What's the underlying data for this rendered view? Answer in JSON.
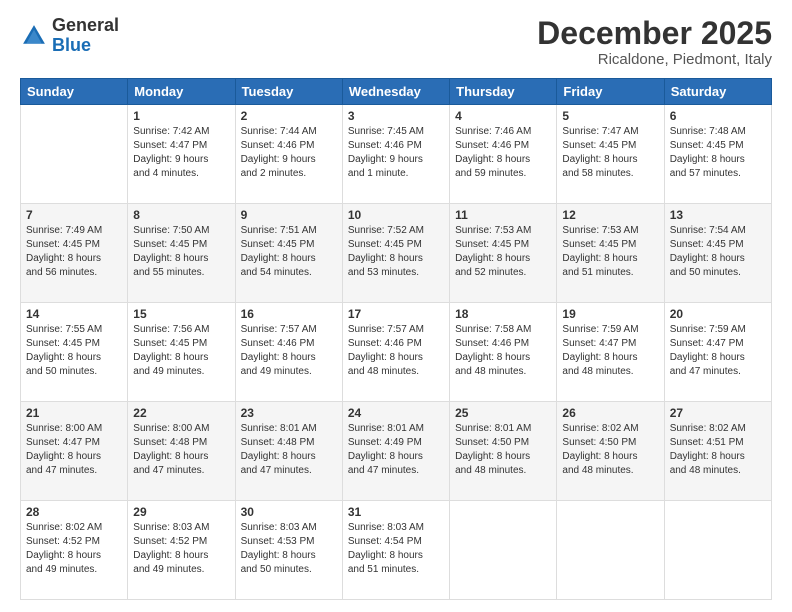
{
  "header": {
    "logo_general": "General",
    "logo_blue": "Blue",
    "month": "December 2025",
    "location": "Ricaldone, Piedmont, Italy"
  },
  "days_of_week": [
    "Sunday",
    "Monday",
    "Tuesday",
    "Wednesday",
    "Thursday",
    "Friday",
    "Saturday"
  ],
  "weeks": [
    [
      {
        "day": "",
        "info": ""
      },
      {
        "day": "1",
        "info": "Sunrise: 7:42 AM\nSunset: 4:47 PM\nDaylight: 9 hours\nand 4 minutes."
      },
      {
        "day": "2",
        "info": "Sunrise: 7:44 AM\nSunset: 4:46 PM\nDaylight: 9 hours\nand 2 minutes."
      },
      {
        "day": "3",
        "info": "Sunrise: 7:45 AM\nSunset: 4:46 PM\nDaylight: 9 hours\nand 1 minute."
      },
      {
        "day": "4",
        "info": "Sunrise: 7:46 AM\nSunset: 4:46 PM\nDaylight: 8 hours\nand 59 minutes."
      },
      {
        "day": "5",
        "info": "Sunrise: 7:47 AM\nSunset: 4:45 PM\nDaylight: 8 hours\nand 58 minutes."
      },
      {
        "day": "6",
        "info": "Sunrise: 7:48 AM\nSunset: 4:45 PM\nDaylight: 8 hours\nand 57 minutes."
      }
    ],
    [
      {
        "day": "7",
        "info": "Sunrise: 7:49 AM\nSunset: 4:45 PM\nDaylight: 8 hours\nand 56 minutes."
      },
      {
        "day": "8",
        "info": "Sunrise: 7:50 AM\nSunset: 4:45 PM\nDaylight: 8 hours\nand 55 minutes."
      },
      {
        "day": "9",
        "info": "Sunrise: 7:51 AM\nSunset: 4:45 PM\nDaylight: 8 hours\nand 54 minutes."
      },
      {
        "day": "10",
        "info": "Sunrise: 7:52 AM\nSunset: 4:45 PM\nDaylight: 8 hours\nand 53 minutes."
      },
      {
        "day": "11",
        "info": "Sunrise: 7:53 AM\nSunset: 4:45 PM\nDaylight: 8 hours\nand 52 minutes."
      },
      {
        "day": "12",
        "info": "Sunrise: 7:53 AM\nSunset: 4:45 PM\nDaylight: 8 hours\nand 51 minutes."
      },
      {
        "day": "13",
        "info": "Sunrise: 7:54 AM\nSunset: 4:45 PM\nDaylight: 8 hours\nand 50 minutes."
      }
    ],
    [
      {
        "day": "14",
        "info": "Sunrise: 7:55 AM\nSunset: 4:45 PM\nDaylight: 8 hours\nand 50 minutes."
      },
      {
        "day": "15",
        "info": "Sunrise: 7:56 AM\nSunset: 4:45 PM\nDaylight: 8 hours\nand 49 minutes."
      },
      {
        "day": "16",
        "info": "Sunrise: 7:57 AM\nSunset: 4:46 PM\nDaylight: 8 hours\nand 49 minutes."
      },
      {
        "day": "17",
        "info": "Sunrise: 7:57 AM\nSunset: 4:46 PM\nDaylight: 8 hours\nand 48 minutes."
      },
      {
        "day": "18",
        "info": "Sunrise: 7:58 AM\nSunset: 4:46 PM\nDaylight: 8 hours\nand 48 minutes."
      },
      {
        "day": "19",
        "info": "Sunrise: 7:59 AM\nSunset: 4:47 PM\nDaylight: 8 hours\nand 48 minutes."
      },
      {
        "day": "20",
        "info": "Sunrise: 7:59 AM\nSunset: 4:47 PM\nDaylight: 8 hours\nand 47 minutes."
      }
    ],
    [
      {
        "day": "21",
        "info": "Sunrise: 8:00 AM\nSunset: 4:47 PM\nDaylight: 8 hours\nand 47 minutes."
      },
      {
        "day": "22",
        "info": "Sunrise: 8:00 AM\nSunset: 4:48 PM\nDaylight: 8 hours\nand 47 minutes."
      },
      {
        "day": "23",
        "info": "Sunrise: 8:01 AM\nSunset: 4:48 PM\nDaylight: 8 hours\nand 47 minutes."
      },
      {
        "day": "24",
        "info": "Sunrise: 8:01 AM\nSunset: 4:49 PM\nDaylight: 8 hours\nand 47 minutes."
      },
      {
        "day": "25",
        "info": "Sunrise: 8:01 AM\nSunset: 4:50 PM\nDaylight: 8 hours\nand 48 minutes."
      },
      {
        "day": "26",
        "info": "Sunrise: 8:02 AM\nSunset: 4:50 PM\nDaylight: 8 hours\nand 48 minutes."
      },
      {
        "day": "27",
        "info": "Sunrise: 8:02 AM\nSunset: 4:51 PM\nDaylight: 8 hours\nand 48 minutes."
      }
    ],
    [
      {
        "day": "28",
        "info": "Sunrise: 8:02 AM\nSunset: 4:52 PM\nDaylight: 8 hours\nand 49 minutes."
      },
      {
        "day": "29",
        "info": "Sunrise: 8:03 AM\nSunset: 4:52 PM\nDaylight: 8 hours\nand 49 minutes."
      },
      {
        "day": "30",
        "info": "Sunrise: 8:03 AM\nSunset: 4:53 PM\nDaylight: 8 hours\nand 50 minutes."
      },
      {
        "day": "31",
        "info": "Sunrise: 8:03 AM\nSunset: 4:54 PM\nDaylight: 8 hours\nand 51 minutes."
      },
      {
        "day": "",
        "info": ""
      },
      {
        "day": "",
        "info": ""
      },
      {
        "day": "",
        "info": ""
      }
    ]
  ]
}
